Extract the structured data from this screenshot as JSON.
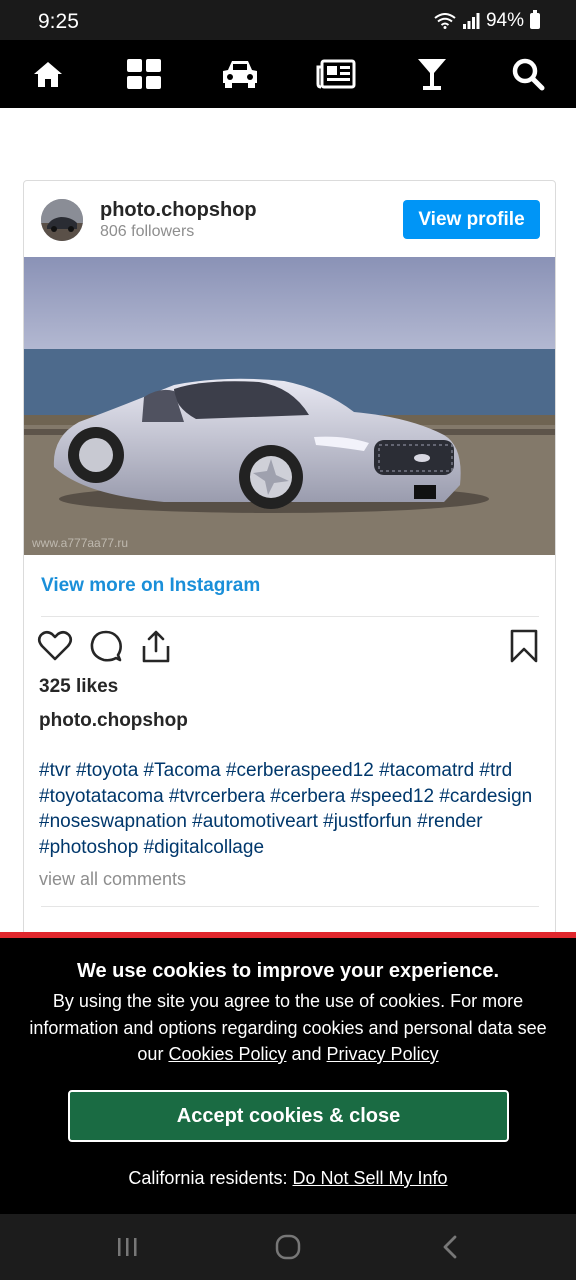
{
  "status_bar": {
    "time": "9:25",
    "battery": "94%"
  },
  "nav": {
    "items": [
      {
        "icon": "home-icon"
      },
      {
        "icon": "grid-icon"
      },
      {
        "icon": "car-icon"
      },
      {
        "icon": "newspaper-icon"
      },
      {
        "icon": "cocktail-icon"
      },
      {
        "icon": "search-icon"
      }
    ]
  },
  "post": {
    "username": "photo.chopshop",
    "followers": "806 followers",
    "view_profile_label": "View profile",
    "watermark": "www.a777aa77.ru",
    "view_more_label": "View more on Instagram",
    "likes": "325 likes",
    "caption_user": "photo.chopshop",
    "hashtags": "#tvr #toyota #Tacoma #cerberaspeed12 #tacomatrd #trd #toyotatacoma #tvrcerbera #cerbera #speed12 #cardesign #noseswapnation #automotiveart #justforfun #render #photoshop #digitalcollage",
    "comments_link": "view all comments",
    "icons": [
      "heart-icon",
      "comment-icon",
      "share-icon",
      "bookmark-icon"
    ]
  },
  "cookie_banner": {
    "title": "We use cookies to improve your experience.",
    "text_before": "By using the site you agree to the use of cookies. For more information and options regarding cookies and personal data see our ",
    "cookies_policy_link": "Cookies Policy",
    "and_text": " and ",
    "privacy_policy_link": "Privacy Policy",
    "accept_label": "Accept cookies & close",
    "california_label": "California residents: ",
    "do_not_sell_link": "Do Not Sell My Info",
    "accent_color": "#1a6b43",
    "border_color": "#e0272d"
  },
  "system_nav": {
    "icons": [
      "recents-icon",
      "home-circle-icon",
      "back-icon"
    ]
  }
}
